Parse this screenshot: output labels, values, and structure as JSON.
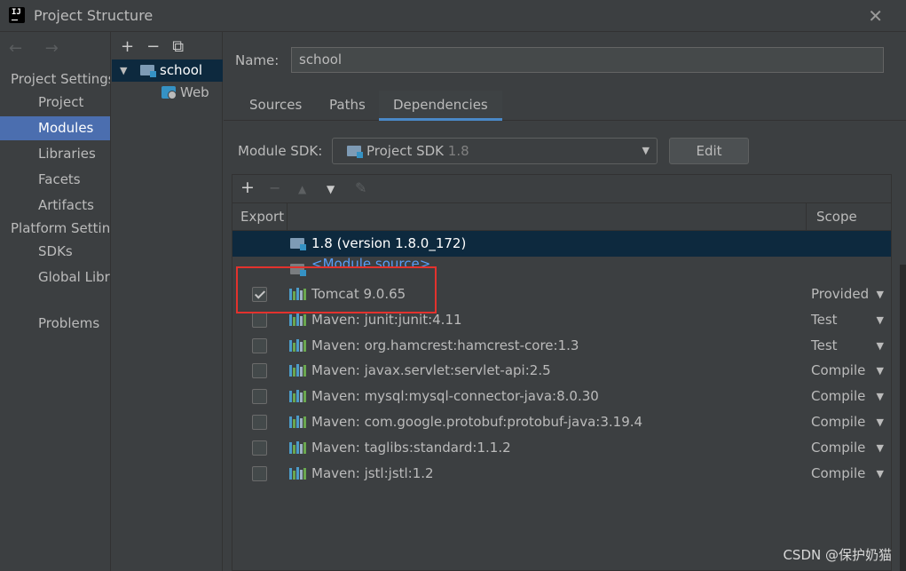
{
  "window": {
    "title": "Project Structure",
    "close_icon": "close-icon"
  },
  "left_nav": {
    "back_forward": "← →",
    "project_settings_header": "Project Settings",
    "project_settings_items": [
      {
        "label": "Project",
        "selected": false
      },
      {
        "label": "Modules",
        "selected": true
      },
      {
        "label": "Libraries",
        "selected": false
      },
      {
        "label": "Facets",
        "selected": false
      },
      {
        "label": "Artifacts",
        "selected": false
      }
    ],
    "platform_settings_header": "Platform Settings",
    "platform_settings_items": [
      {
        "label": "SDKs"
      },
      {
        "label": "Global Libraries"
      }
    ],
    "problems_label": "Problems"
  },
  "module_tree": {
    "toolbar": {
      "add": "+",
      "remove": "−",
      "copy": "⧉"
    },
    "root": {
      "label": "school",
      "expanded": true,
      "selected": true
    },
    "children": [
      {
        "label": "Web"
      }
    ]
  },
  "module": {
    "name_label": "Name:",
    "name_value": "school",
    "tabs": [
      {
        "label": "Sources",
        "active": false
      },
      {
        "label": "Paths",
        "active": false
      },
      {
        "label": "Dependencies",
        "active": true
      }
    ],
    "sdk_label": "Module SDK:",
    "sdk_value": "Project SDK",
    "sdk_version": "1.8",
    "edit_label": "Edit"
  },
  "dependencies": {
    "toolbar": {
      "add": "+",
      "remove": "−",
      "up": "▲",
      "down": "▼",
      "edit": "✎"
    },
    "headers": {
      "export": "Export",
      "scope": "Scope"
    },
    "rows": [
      {
        "name": "1.8 (version 1.8.0_172)",
        "type": "sdk",
        "selected": true,
        "has_checkbox": false,
        "checked": false,
        "scope": ""
      },
      {
        "name": "<Module source>",
        "type": "source",
        "selected": false,
        "has_checkbox": false,
        "checked": false,
        "scope": ""
      },
      {
        "name": "Tomcat 9.0.65",
        "type": "library",
        "selected": false,
        "has_checkbox": true,
        "checked": true,
        "scope": "Provided"
      },
      {
        "name": "Maven: junit:junit:4.11",
        "type": "library",
        "selected": false,
        "has_checkbox": true,
        "checked": false,
        "scope": "Test"
      },
      {
        "name": "Maven: org.hamcrest:hamcrest-core:1.3",
        "type": "library",
        "selected": false,
        "has_checkbox": true,
        "checked": false,
        "scope": "Test"
      },
      {
        "name": "Maven: javax.servlet:servlet-api:2.5",
        "type": "library",
        "selected": false,
        "has_checkbox": true,
        "checked": false,
        "scope": "Compile"
      },
      {
        "name": "Maven: mysql:mysql-connector-java:8.0.30",
        "type": "library",
        "selected": false,
        "has_checkbox": true,
        "checked": false,
        "scope": "Compile"
      },
      {
        "name": "Maven: com.google.protobuf:protobuf-java:3.19.4",
        "type": "library",
        "selected": false,
        "has_checkbox": true,
        "checked": false,
        "scope": "Compile"
      },
      {
        "name": "Maven: taglibs:standard:1.1.2",
        "type": "library",
        "selected": false,
        "has_checkbox": true,
        "checked": false,
        "scope": "Compile"
      },
      {
        "name": "Maven: jstl:jstl:1.2",
        "type": "library",
        "selected": false,
        "has_checkbox": true,
        "checked": false,
        "scope": "Compile"
      }
    ]
  },
  "colors": {
    "accent": "#4b6eaf",
    "selection": "#0d293e",
    "link": "#589df6",
    "highlight_box": "#e3322d"
  },
  "watermark": "CSDN @保护奶猫"
}
